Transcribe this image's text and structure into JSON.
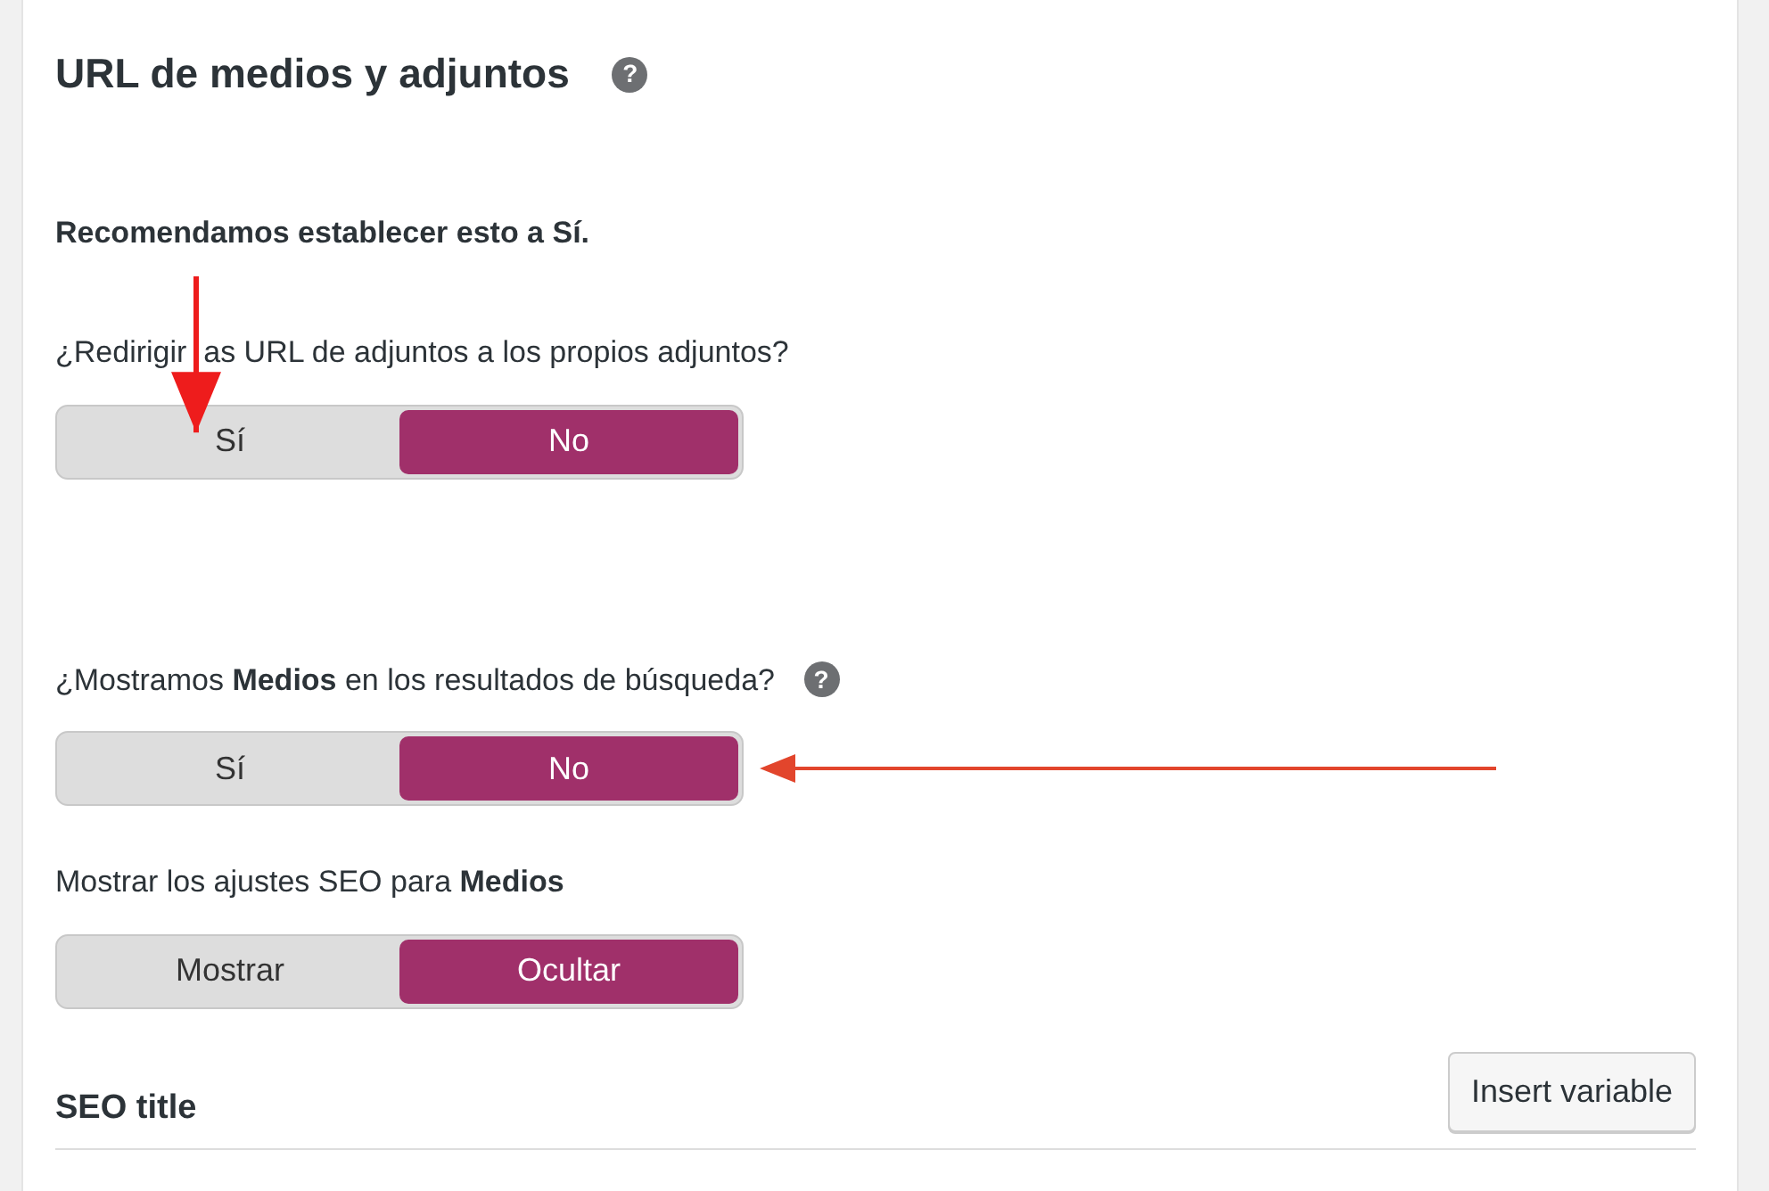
{
  "section": {
    "title": "URL de medios y adjuntos",
    "help": "?"
  },
  "recommendation": "Recomendamos establecer esto a Sí.",
  "settings": [
    {
      "label": "¿Redirigir  as URL de adjuntos a los propios adjuntos?",
      "help": false,
      "options": [
        {
          "label": "Sí",
          "selected": false
        },
        {
          "label": "No",
          "selected": true
        }
      ]
    },
    {
      "label": "¿Mostramos **Medios** en los resultados de búsqueda?",
      "help": true,
      "options": [
        {
          "label": "Sí",
          "selected": false
        },
        {
          "label": "No",
          "selected": true
        }
      ]
    },
    {
      "label": "Mostrar los ajustes SEO para **Medios**",
      "help": false,
      "options": [
        {
          "label": "Mostrar",
          "selected": false
        },
        {
          "label": "Ocultar",
          "selected": true
        }
      ]
    }
  ],
  "seo_title": {
    "label": "SEO title",
    "button": "Insert variable"
  },
  "annotations": [
    {
      "kind": "downarrow",
      "color": "#ee1c1c"
    },
    {
      "kind": "leftarrow",
      "color": "#e2452c"
    }
  ]
}
